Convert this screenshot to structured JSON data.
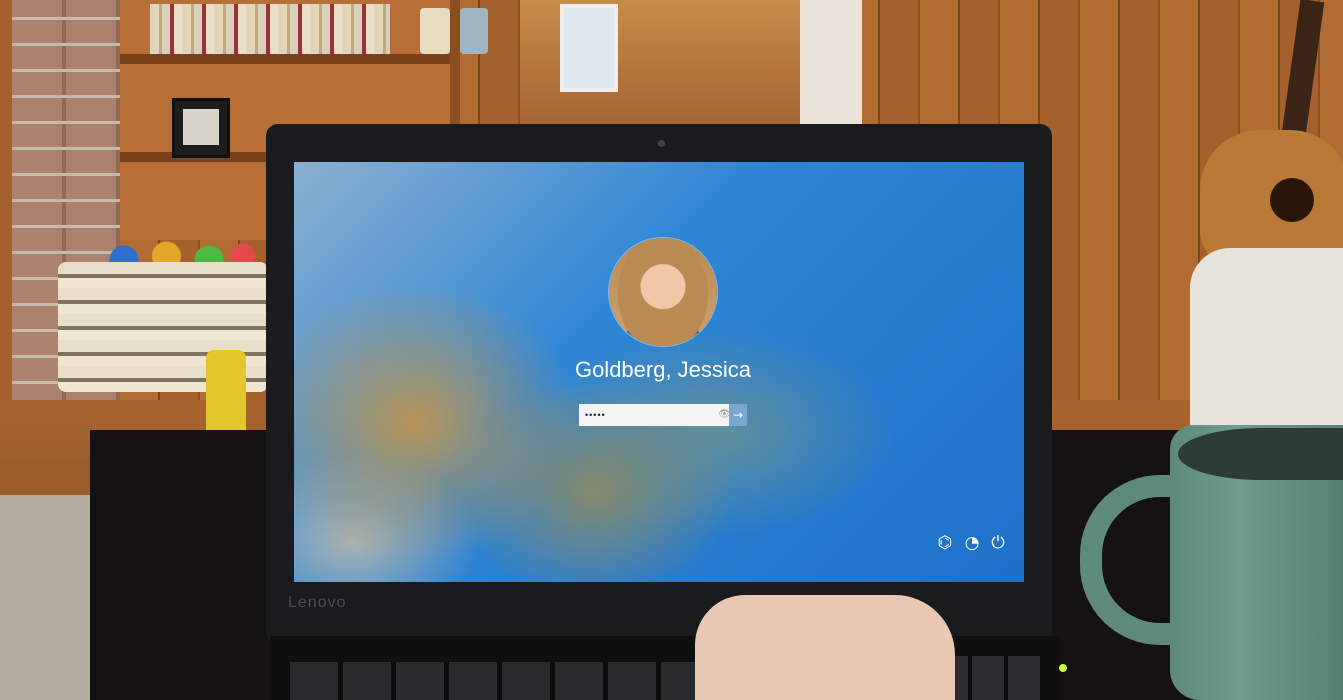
{
  "lock_screen": {
    "user_name": "Goldberg, Jessica",
    "password_value": "•••••",
    "reveal_glyph": "👁",
    "submit_glyph": "→",
    "network_glyph": "⌬",
    "ease_glyph": "◔",
    "power_glyph": "⏻"
  },
  "laptop": {
    "brand": "Lenovo"
  },
  "colors": {
    "accent": "#1e70c8",
    "submit_button": "#7aa7cf"
  }
}
